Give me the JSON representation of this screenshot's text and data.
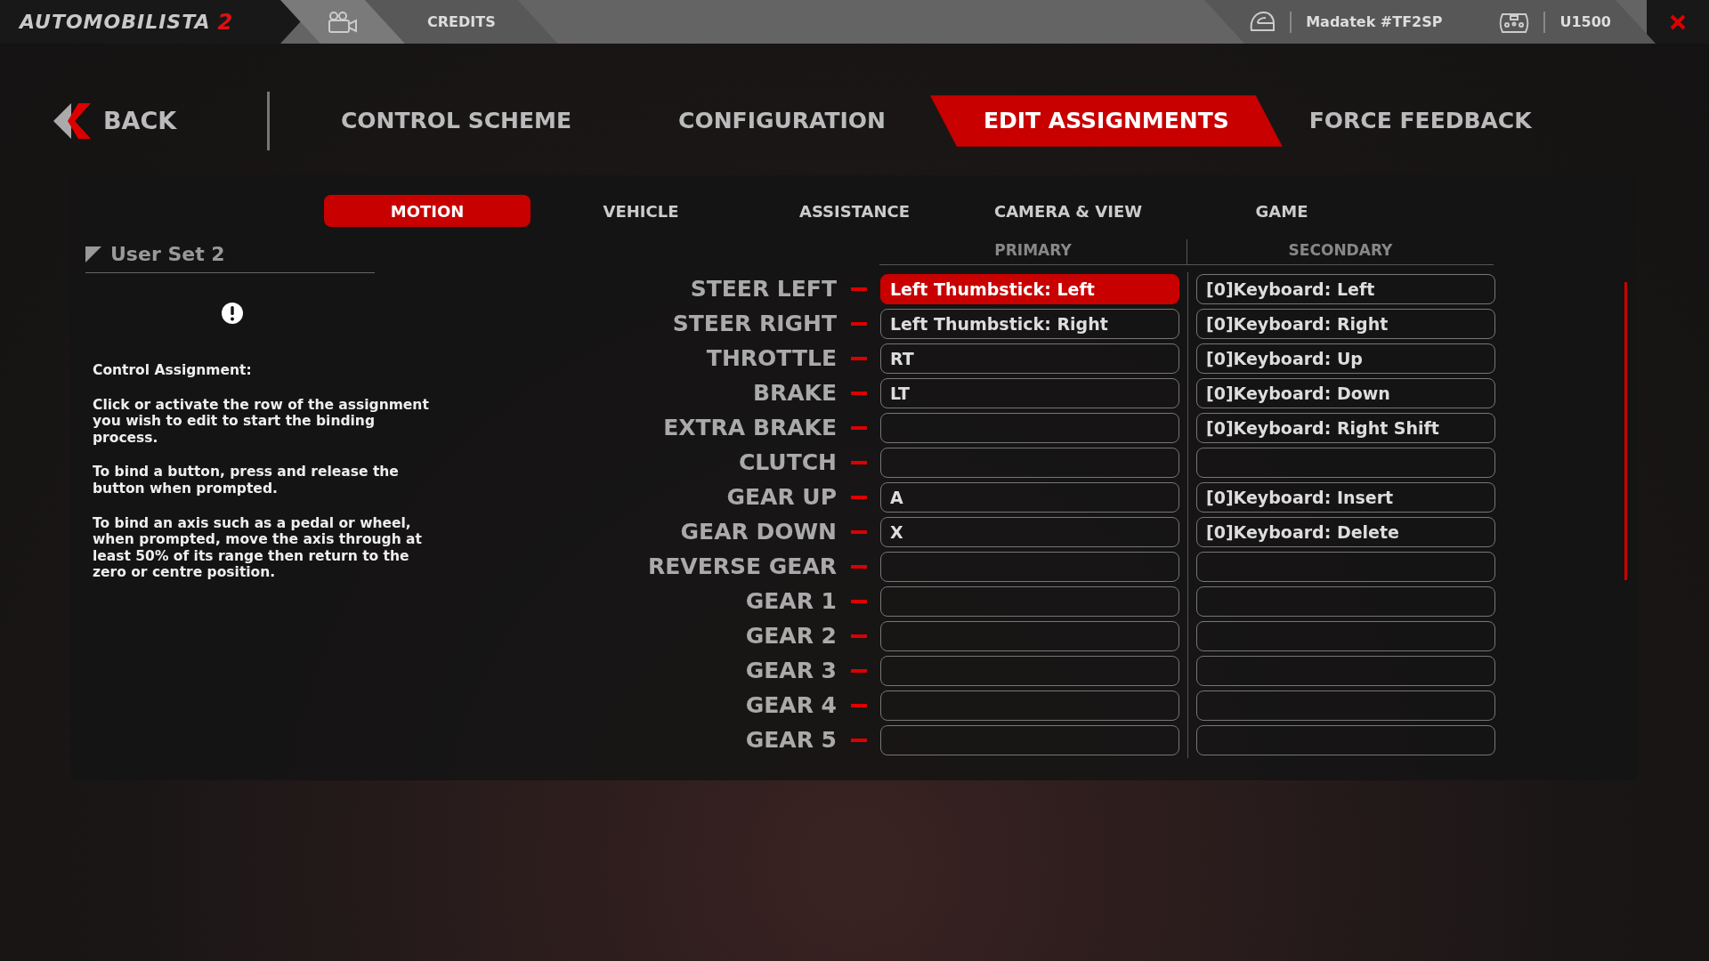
{
  "top_bar": {
    "logo_text": "AUTOMOBILISTA",
    "logo_number": "2",
    "credits": "CREDITS",
    "driver": "Madatek #TF2SP",
    "controller": "U1500"
  },
  "back": "BACK",
  "tabs": [
    {
      "label": "CONTROL SCHEME",
      "selected": false
    },
    {
      "label": "CONFIGURATION",
      "selected": false
    },
    {
      "label": "EDIT ASSIGNMENTS",
      "selected": true
    },
    {
      "label": "FORCE FEEDBACK",
      "selected": false
    }
  ],
  "subtabs": [
    {
      "label": "MOTION",
      "selected": true
    },
    {
      "label": "VEHICLE",
      "selected": false
    },
    {
      "label": "ASSISTANCE",
      "selected": false
    },
    {
      "label": "CAMERA & VIEW",
      "selected": false
    },
    {
      "label": "GAME",
      "selected": false
    }
  ],
  "user_set": "User Set 2",
  "help": {
    "title": "Control Assignment:",
    "paragraphs": [
      "Click or activate the row of the assignment you wish to edit to start the binding process.",
      "To bind a button, press and release the button when prompted.",
      "To bind an axis such as a pedal or wheel, when prompted, move the axis through at least 50% of its range then return to the zero or centre position."
    ]
  },
  "columns": [
    "PRIMARY",
    "SECONDARY"
  ],
  "rows": [
    {
      "label": "STEER LEFT",
      "primary": "Left Thumbstick: Left",
      "secondary": "[0]Keyboard: Left",
      "selected": true
    },
    {
      "label": "STEER RIGHT",
      "primary": "Left Thumbstick: Right",
      "secondary": "[0]Keyboard: Right",
      "selected": false
    },
    {
      "label": "THROTTLE",
      "primary": "RT",
      "secondary": "[0]Keyboard: Up",
      "selected": false
    },
    {
      "label": "BRAKE",
      "primary": "LT",
      "secondary": "[0]Keyboard: Down",
      "selected": false
    },
    {
      "label": "EXTRA BRAKE",
      "primary": "",
      "secondary": "[0]Keyboard: Right Shift",
      "selected": false
    },
    {
      "label": "CLUTCH",
      "primary": "",
      "secondary": "",
      "selected": false
    },
    {
      "label": "GEAR UP",
      "primary": "A",
      "secondary": "[0]Keyboard: Insert",
      "selected": false
    },
    {
      "label": "GEAR DOWN",
      "primary": "X",
      "secondary": "[0]Keyboard: Delete",
      "selected": false
    },
    {
      "label": "REVERSE GEAR",
      "primary": "",
      "secondary": "",
      "selected": false
    },
    {
      "label": "GEAR 1",
      "primary": "",
      "secondary": "",
      "selected": false
    },
    {
      "label": "GEAR 2",
      "primary": "",
      "secondary": "",
      "selected": false
    },
    {
      "label": "GEAR 3",
      "primary": "",
      "secondary": "",
      "selected": false
    },
    {
      "label": "GEAR 4",
      "primary": "",
      "secondary": "",
      "selected": false
    },
    {
      "label": "GEAR 5",
      "primary": "",
      "secondary": "",
      "selected": false
    }
  ]
}
